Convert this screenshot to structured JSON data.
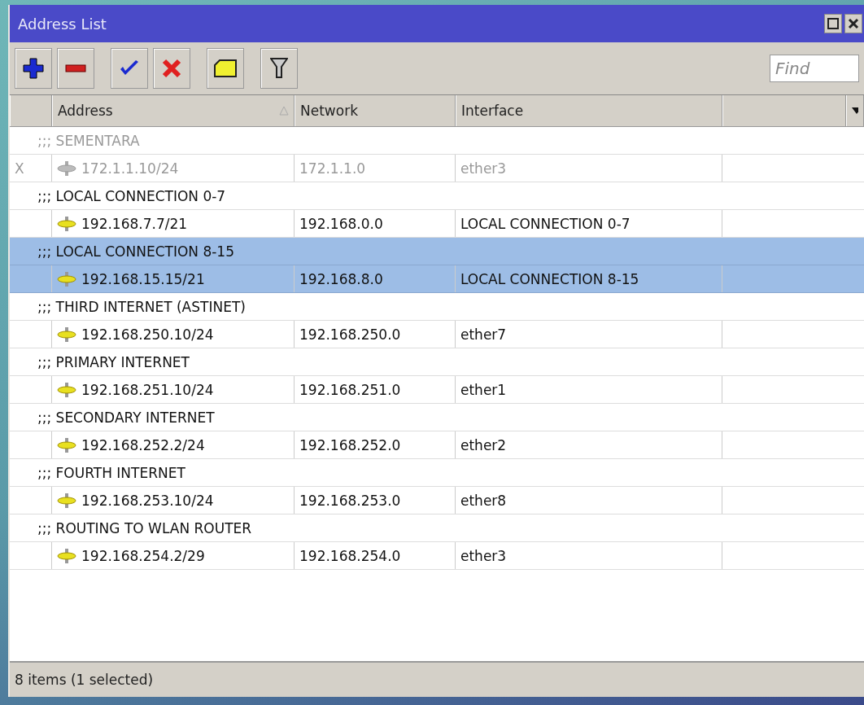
{
  "window": {
    "title": "Address List"
  },
  "toolbar": {
    "find": {
      "placeholder": "Find"
    }
  },
  "table": {
    "columns": [
      {},
      {
        "label": "Address",
        "sorted": true
      },
      {
        "label": "Network"
      },
      {
        "label": "Interface"
      },
      {}
    ],
    "items": [
      {
        "comment": ";;; SEMENTARA",
        "flag": "X",
        "address": "172.1.1.10/24",
        "network": "172.1.1.0",
        "interface": "ether3",
        "disabled": true,
        "selected": false
      },
      {
        "comment": ";;; LOCAL CONNECTION 0-7",
        "address": "192.168.7.7/21",
        "network": "192.168.0.0",
        "interface": "LOCAL CONNECTION 0-7",
        "disabled": false,
        "selected": false
      },
      {
        "comment": ";;; LOCAL CONNECTION 8-15",
        "address": "192.168.15.15/21",
        "network": "192.168.8.0",
        "interface": "LOCAL CONNECTION 8-15",
        "disabled": false,
        "selected": true
      },
      {
        "comment": ";;; THIRD INTERNET (ASTINET)",
        "address": "192.168.250.10/24",
        "network": "192.168.250.0",
        "interface": "ether7",
        "disabled": false,
        "selected": false
      },
      {
        "comment": ";;; PRIMARY INTERNET",
        "address": "192.168.251.10/24",
        "network": "192.168.251.0",
        "interface": "ether1",
        "disabled": false,
        "selected": false
      },
      {
        "comment": ";;; SECONDARY INTERNET",
        "address": "192.168.252.2/24",
        "network": "192.168.252.0",
        "interface": "ether2",
        "disabled": false,
        "selected": false
      },
      {
        "comment": ";;; FOURTH INTERNET",
        "address": "192.168.253.10/24",
        "network": "192.168.253.0",
        "interface": "ether8",
        "disabled": false,
        "selected": false
      },
      {
        "comment": ";;; ROUTING TO WLAN ROUTER",
        "address": "192.168.254.2/29",
        "network": "192.168.254.0",
        "interface": "ether3",
        "disabled": false,
        "selected": false
      }
    ]
  },
  "status_bar": {
    "text": "8 items (1 selected)"
  }
}
